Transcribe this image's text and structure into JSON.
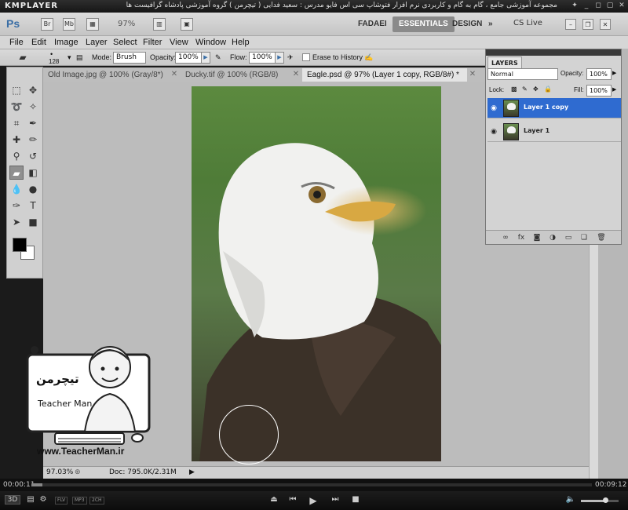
{
  "player": {
    "logo": "KMPLAYER",
    "title": "مجموعه آموزشی جامع ، گام به گام و کاربردی نرم افزار فتوشاپ سی اس فایو   مدرس : سعید فدایی ( تیچرمن ) گروه آموزشی پادشاه گرافیست ها",
    "elapsed": "00:00:11",
    "total": "00:09:12",
    "format_tags": [
      "FLV",
      "MP3",
      "2CH"
    ],
    "mode_label": "3D"
  },
  "appbar": {
    "logo": "Ps",
    "br_label": "Br",
    "mb_label": "Mb",
    "zoom": "97%",
    "workspaces": [
      "FADAEI",
      "ESSENTIALS",
      "DESIGN"
    ],
    "active_workspace": "ESSENTIALS",
    "cs_live": "CS Live"
  },
  "menu": [
    "File",
    "Edit",
    "Image",
    "Layer",
    "Select",
    "Filter",
    "View",
    "Window",
    "Help"
  ],
  "options": {
    "brush_size": "128",
    "mode_label": "Mode:",
    "mode_value": "Brush",
    "opacity_label": "Opacity:",
    "opacity_value": "100%",
    "flow_label": "Flow:",
    "flow_value": "100%",
    "erase_history_label": "Erase to History"
  },
  "tabs": [
    {
      "label": "Old Image.jpg @ 100% (Gray/8*)"
    },
    {
      "label": "Ducky.tif @ 100% (RGB/8)"
    },
    {
      "label": "Eagle.psd @ 97% (Layer 1 copy, RGB/8#) *"
    }
  ],
  "status": {
    "zoom": "97.03%",
    "doc": "Doc: 795.0K/2.31M"
  },
  "layers_panel": {
    "tab": "LAYERS",
    "blend_mode": "Normal",
    "opacity_label": "Opacity:",
    "opacity_value": "100%",
    "lock_label": "Lock:",
    "fill_label": "Fill:",
    "fill_value": "100%",
    "layers": [
      {
        "name": "Layer 1 copy",
        "selected": true
      },
      {
        "name": "Layer 1",
        "selected": false
      }
    ]
  },
  "watermark": {
    "brand_fa": "تیچرمن",
    "brand_en": "Teacher Man",
    "url": "www.TeacherMan.ir"
  },
  "colors": {
    "accent": "#2f6bd0",
    "ps_blue": "#3a6ea5"
  },
  "playback_progress": 0.02
}
